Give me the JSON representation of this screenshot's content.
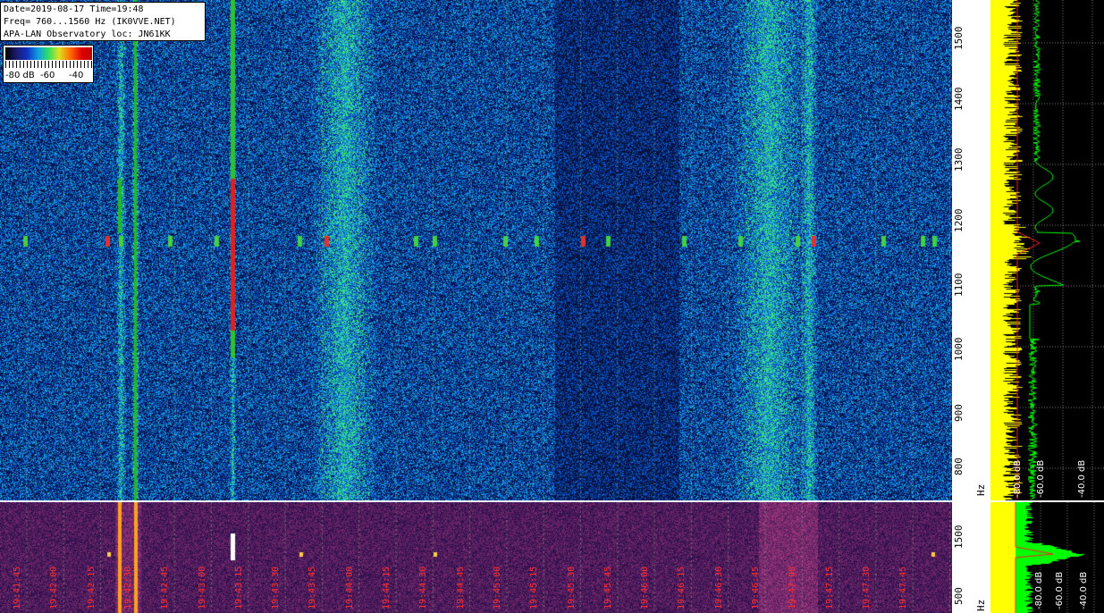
{
  "info": {
    "line1": "Date=2019-08-17 Time=19:48",
    "line2": "Freq= 760...1560 Hz (IK0VVE.NET)",
    "line3": "APA-LAN Observatory loc: JN61KK"
  },
  "scale": {
    "labels": [
      "-80 dB",
      "-60",
      "-40"
    ]
  },
  "axis_top": {
    "unit": "Hz",
    "ticks": [
      "1500",
      "1400",
      "1300",
      "1200",
      "1100",
      "1000",
      "900",
      "800"
    ]
  },
  "axis_bottom": {
    "unit": "Hz",
    "ticks": [
      "1500",
      "500"
    ]
  },
  "spectrum_db_labels": [
    "-80.0 dB",
    "-60.0 dB",
    "-40.0 dB"
  ],
  "time_labels": [
    "19:41:45",
    "19:42:00",
    "19:42:15",
    "19:42:30",
    "19:42:45",
    "19:43:00",
    "19:43:15",
    "19:43:30",
    "19:43:45",
    "19:44:00",
    "19:44:15",
    "19:44:30",
    "19:44:45",
    "19:45:00",
    "19:45:15",
    "19:45:30",
    "19:45:45",
    "19:46:00",
    "19:46:15",
    "19:46:30",
    "19:46:45",
    "19:47:00",
    "19:47:15",
    "19:47:30",
    "19:47:45"
  ],
  "colors": {
    "noise_blue": "#1030c0",
    "signal_red": "#e00000",
    "spectrum_yellow": "#ffff00",
    "spectrum_green": "#00ff00",
    "time_red": "#ff3030"
  }
}
